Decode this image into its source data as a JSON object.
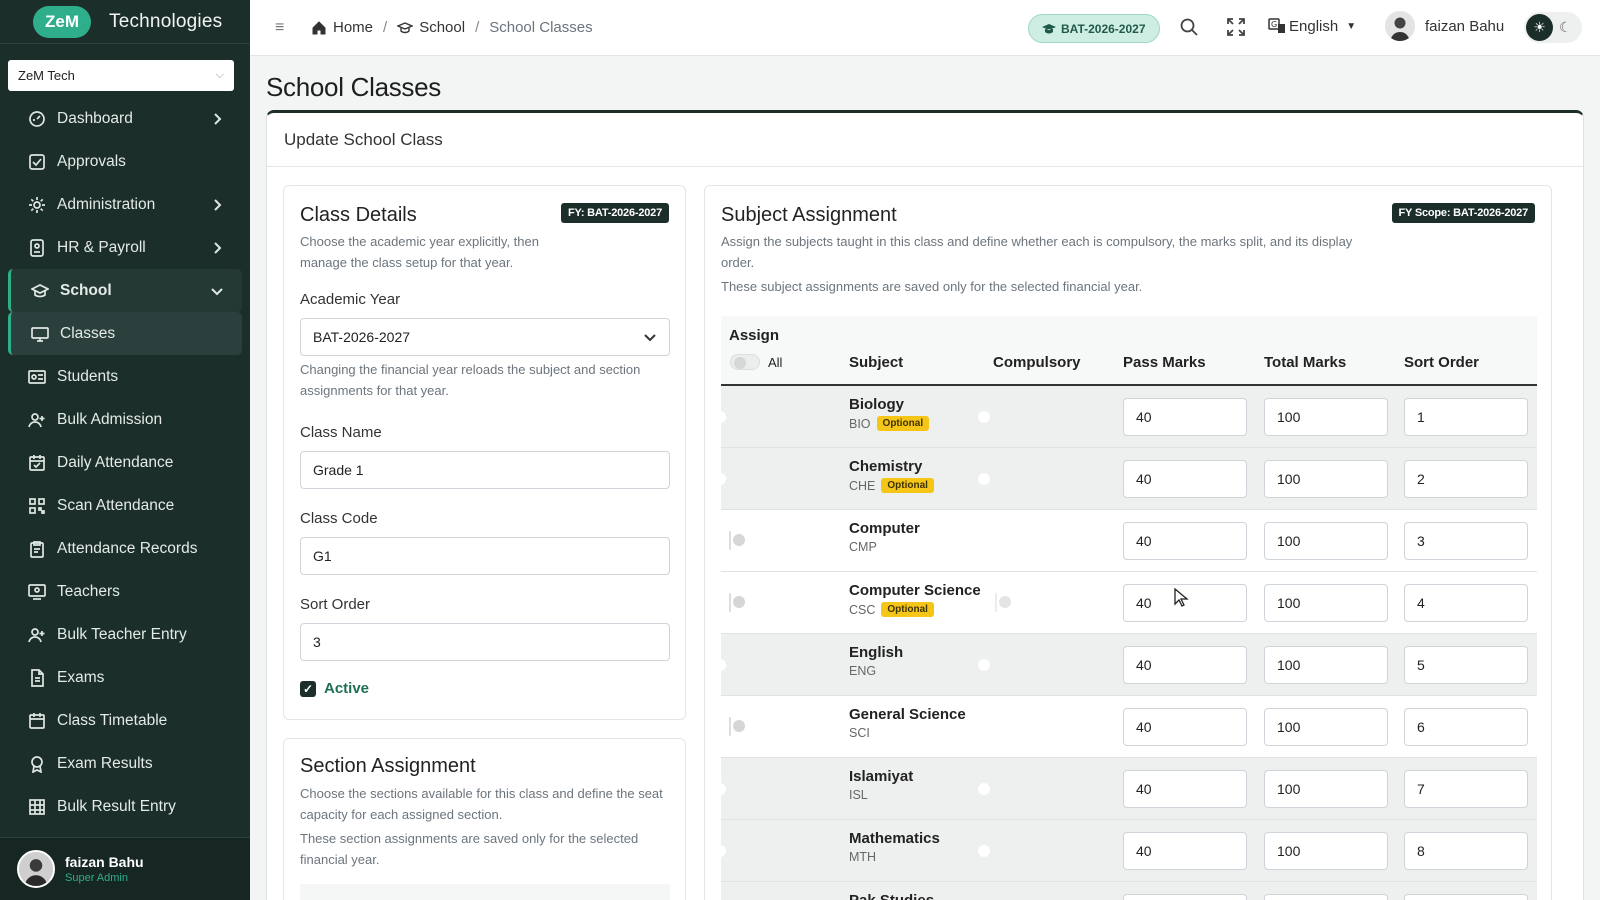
{
  "brand": {
    "logo": "ZeM",
    "name": "Technologies"
  },
  "org_select": {
    "value": "ZeM Tech"
  },
  "nav": [
    {
      "label": "Dashboard",
      "icon": "dashboard-icon",
      "arrow": "right"
    },
    {
      "label": "Approvals",
      "icon": "check-square-icon"
    },
    {
      "label": "Administration",
      "icon": "gear-icon",
      "arrow": "right"
    },
    {
      "label": "HR & Payroll",
      "icon": "id-card-icon",
      "arrow": "right"
    },
    {
      "label": "School",
      "icon": "graduation-cap-icon",
      "arrow": "down"
    },
    {
      "label": "Classes",
      "icon": "monitor-icon"
    },
    {
      "label": "Students",
      "icon": "id-badge-icon"
    },
    {
      "label": "Bulk Admission",
      "icon": "user-plus-icon"
    },
    {
      "label": "Daily Attendance",
      "icon": "calendar-check-icon"
    },
    {
      "label": "Scan Attendance",
      "icon": "qr-code-icon"
    },
    {
      "label": "Attendance Records",
      "icon": "clipboard-icon"
    },
    {
      "label": "Teachers",
      "icon": "teacher-board-icon"
    },
    {
      "label": "Bulk Teacher Entry",
      "icon": "user-plus-icon"
    },
    {
      "label": "Exams",
      "icon": "document-icon"
    },
    {
      "label": "Class Timetable",
      "icon": "calendar-icon"
    },
    {
      "label": "Exam Results",
      "icon": "award-icon"
    },
    {
      "label": "Bulk Result Entry",
      "icon": "grid-icon"
    }
  ],
  "sidebar_user": {
    "name": "faizan Bahu",
    "role": "Super Admin"
  },
  "topbar": {
    "breadcrumb": [
      "Home",
      "School",
      "School Classes"
    ],
    "year_badge": "BAT-2026-2027",
    "language": "English",
    "user": "faizan Bahu"
  },
  "page_title": "School Classes",
  "card_title": "Update School Class",
  "class_details": {
    "title": "Class Details",
    "fy_pill": "FY: BAT-2026-2027",
    "desc": "Choose the academic year explicitly, then manage the class setup for that year.",
    "academic_year_label": "Academic Year",
    "academic_year_value": "BAT-2026-2027",
    "academic_year_help": "Changing the financial year reloads the subject and section assignments for that year.",
    "class_name_label": "Class Name",
    "class_name_value": "Grade 1",
    "class_code_label": "Class Code",
    "class_code_value": "G1",
    "sort_order_label": "Sort Order",
    "sort_order_value": "3",
    "active_label": "Active"
  },
  "section_assignment": {
    "title": "Section Assignment",
    "desc": "Choose the sections available for this class and define the seat capacity for each assigned section.",
    "note": "These section assignments are saved only for the selected financial year."
  },
  "subject_assignment": {
    "title": "Subject Assignment",
    "fy_pill": "FY Scope: BAT-2026-2027",
    "desc": "Assign the subjects taught in this class and define whether each is compulsory, the marks split, and its display order.",
    "note": "These subject assignments are saved only for the selected financial year.",
    "headers": {
      "assign": "Assign",
      "all": "All",
      "subject": "Subject",
      "compulsory": "Compulsory",
      "pass": "Pass Marks",
      "total": "Total Marks",
      "sort": "Sort Order"
    },
    "rows": [
      {
        "name": "Biology",
        "code": "BIO",
        "optional": "Optional",
        "assigned": true,
        "compulsory": "on",
        "pass": "40",
        "total": "100",
        "sort": "1"
      },
      {
        "name": "Chemistry",
        "code": "CHE",
        "optional": "Optional",
        "assigned": true,
        "compulsory": "on",
        "pass": "40",
        "total": "100",
        "sort": "2"
      },
      {
        "name": "Computer",
        "code": "CMP",
        "optional": "",
        "assigned": false,
        "compulsory": "grey",
        "pass": "40",
        "total": "100",
        "sort": "3"
      },
      {
        "name": "Computer Science",
        "code": "CSC",
        "optional": "Optional",
        "assigned": false,
        "compulsory": "faint",
        "pass": "40",
        "total": "100",
        "sort": "4"
      },
      {
        "name": "English",
        "code": "ENG",
        "optional": "",
        "assigned": true,
        "compulsory": "on",
        "pass": "40",
        "total": "100",
        "sort": "5"
      },
      {
        "name": "General Science",
        "code": "SCI",
        "optional": "",
        "assigned": false,
        "compulsory": "grey",
        "pass": "40",
        "total": "100",
        "sort": "6"
      },
      {
        "name": "Islamiyat",
        "code": "ISL",
        "optional": "",
        "assigned": true,
        "compulsory": "on",
        "pass": "40",
        "total": "100",
        "sort": "7"
      },
      {
        "name": "Mathematics",
        "code": "MTH",
        "optional": "",
        "assigned": true,
        "compulsory": "on",
        "pass": "40",
        "total": "100",
        "sort": "8"
      },
      {
        "name": "Pak Studies",
        "code": "",
        "optional": "",
        "assigned": true,
        "compulsory": "on",
        "pass": "",
        "total": "",
        "sort": ""
      }
    ]
  },
  "colors": {
    "sidebar": "#1b2e2a",
    "accent": "#2fae8c",
    "badge": "#f5c518"
  }
}
